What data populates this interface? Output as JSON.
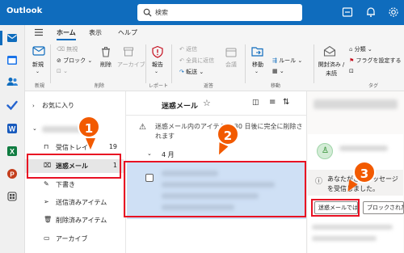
{
  "app": {
    "title": "Outlook"
  },
  "search": {
    "placeholder": "検索"
  },
  "ribbon": {
    "tabs": [
      "ホーム",
      "表示",
      "ヘルプ"
    ],
    "buttons": {
      "new": "新規",
      "delete_row": "削除",
      "block": "ブロック",
      "archive": "アーカイブ",
      "report": "報告",
      "reply": "返信",
      "reply_all": "全員に返信",
      "forward": "転送",
      "summary": "会議",
      "move": "移動",
      "rules": "ルール",
      "read_unread": "開封済み /\n未読",
      "categorize": "分類",
      "flag": "フラグを設定する"
    },
    "groups": {
      "new": "新規",
      "delete": "削除",
      "report": "レポート",
      "respond": "返答",
      "move": "移動",
      "tags": "タグ"
    }
  },
  "folders": {
    "favorites": "お気に入り",
    "account": "...",
    "items": [
      {
        "label": "受信トレイ",
        "count": "19"
      },
      {
        "label": "迷惑メール",
        "count": "1"
      },
      {
        "label": "下書き",
        "count": ""
      },
      {
        "label": "送信済みアイテム",
        "count": ""
      },
      {
        "label": "削除済みアイテム",
        "count": ""
      },
      {
        "label": "アーカイブ",
        "count": ""
      }
    ]
  },
  "list": {
    "title": "迷惑メール",
    "notice": "迷惑メール内のアイテムは 30 日後に完全に削除されます",
    "group_header": "4 月"
  },
  "reading": {
    "warning": "あなたがこのメッセージを受信しました。",
    "not_junk_button": "迷惑メールでは",
    "block_button": "ブロックされた"
  },
  "steps": [
    "1",
    "2",
    "3"
  ],
  "colors": {
    "brand": "#0f6cbd",
    "highlight": "#e81123",
    "badge": "#f25a00",
    "selected": "#cfe0f5"
  }
}
